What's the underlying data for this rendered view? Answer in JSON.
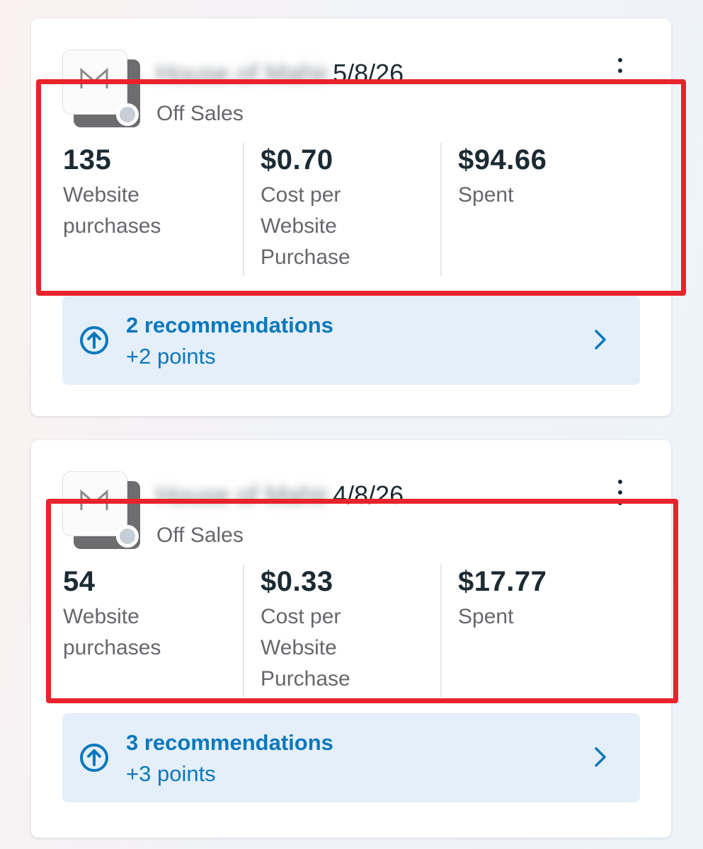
{
  "colors": {
    "accent_blue": "#0a78be",
    "highlight_red": "#e8232b",
    "text_primary": "#1c2b33",
    "text_secondary": "#65676b",
    "status_dot_off": "#c8ced6",
    "reco_background": "#e5eff9"
  },
  "cards": [
    {
      "thumbnail_icon": "brand-logo-m",
      "name_blurred": "House of Mahir",
      "name_date": "5/8/26",
      "status": "Off",
      "objective": "Sales",
      "metrics": [
        {
          "value": "135",
          "label": "Website\npurchases"
        },
        {
          "value": "$0.70",
          "label": "Cost per\nWebsite\nPurchase"
        },
        {
          "value": "$94.66",
          "label": "Spent"
        }
      ],
      "recommendations": {
        "title": "2 recommendations",
        "points": "+2 points",
        "icon": "arrow-up-circle-icon"
      }
    },
    {
      "thumbnail_icon": "brand-logo-m",
      "name_blurred": "House of Mahir",
      "name_date": "4/8/26",
      "status": "Off",
      "objective": "Sales",
      "metrics": [
        {
          "value": "54",
          "label": "Website\npurchases"
        },
        {
          "value": "$0.33",
          "label": "Cost per\nWebsite\nPurchase"
        },
        {
          "value": "$17.77",
          "label": "Spent"
        }
      ],
      "recommendations": {
        "title": "3 recommendations",
        "points": "+3 points",
        "icon": "arrow-up-circle-icon"
      }
    }
  ]
}
